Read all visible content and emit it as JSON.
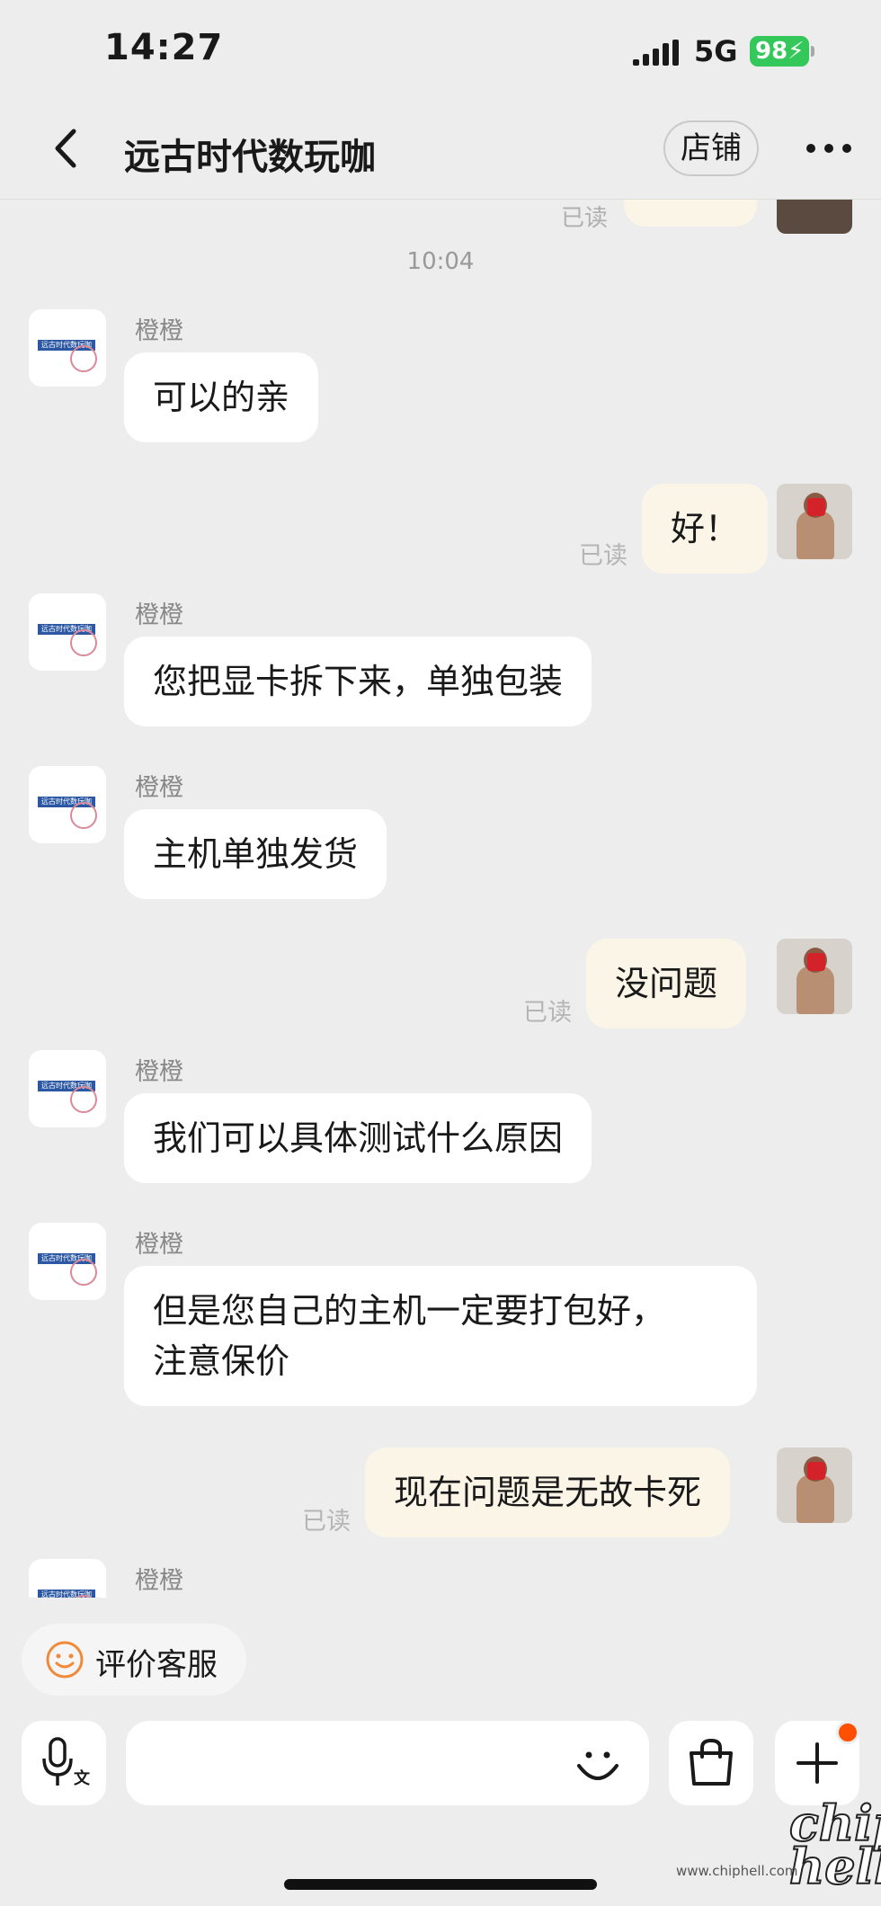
{
  "status_bar": {
    "time": "14:27",
    "network": "5G",
    "battery": "98"
  },
  "header": {
    "title": "远古时代数玩咖",
    "store_label": "店铺"
  },
  "chat": {
    "peek_read": "已读",
    "timestamp": "10:04",
    "messages": [
      {
        "from": "shop",
        "sender": "橙橙",
        "text": "可以的亲"
      },
      {
        "from": "me",
        "text": "好！",
        "read": "已读"
      },
      {
        "from": "shop",
        "sender": "橙橙",
        "text": "您把显卡拆下来，单独包装"
      },
      {
        "from": "shop",
        "sender": "橙橙",
        "text": "主机单独发货"
      },
      {
        "from": "me",
        "text": "没问题",
        "read": "已读"
      },
      {
        "from": "shop",
        "sender": "橙橙",
        "text": "我们可以具体测试什么原因"
      },
      {
        "from": "shop",
        "sender": "橙橙",
        "lines": [
          "但是您自己的主机一定要打包好，",
          "注意保价"
        ]
      },
      {
        "from": "me",
        "text": "现在问题是无故卡死",
        "read": "已读"
      },
      {
        "from": "shop",
        "sender": "橙橙"
      }
    ]
  },
  "rate_service": {
    "label": "评价客服"
  },
  "input_bar": {
    "placeholder": ""
  },
  "watermark": {
    "logo": "chip hell",
    "url": "www.chiphell.com"
  },
  "colors": {
    "my_bubble": "#fbf5e8",
    "shop_bubble": "#ffffff",
    "background": "#ededed",
    "badge": "#ff5000",
    "battery": "#34c759",
    "rate_icon": "#f08a3a"
  }
}
